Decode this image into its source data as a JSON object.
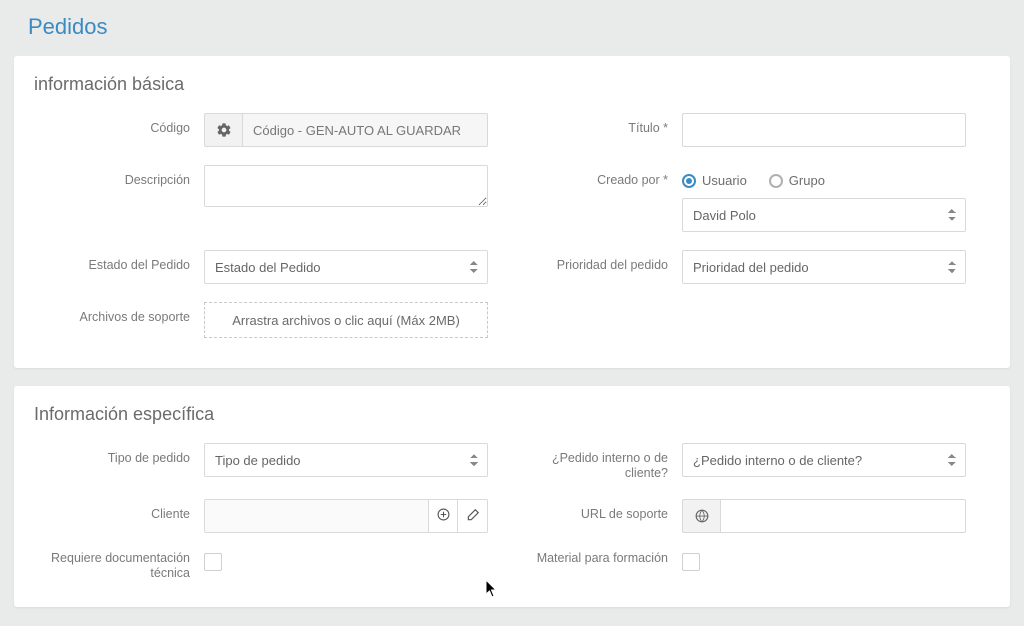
{
  "pageTitle": "Pedidos",
  "panels": {
    "basic": {
      "heading": "información básica",
      "codigoLabel": "Código",
      "codigoPlaceholder": "Código - GEN-AUTO AL GUARDAR",
      "tituloLabel": "Título *",
      "descripcionLabel": "Descripción",
      "creadoPorLabel": "Creado por *",
      "creadoPorOptions": {
        "usuario": "Usuario",
        "grupo": "Grupo"
      },
      "creadoPorSelected": "David Polo",
      "estadoLabel": "Estado del Pedido",
      "estadoPlaceholder": "Estado del Pedido",
      "prioridadLabel": "Prioridad del pedido",
      "prioridadPlaceholder": "Prioridad del pedido",
      "archivosLabel": "Archivos de soporte",
      "archivosHint": "Arrastra archivos o clic aquí (Máx 2MB)"
    },
    "specific": {
      "heading": "Información específica",
      "tipoLabel": "Tipo de pedido",
      "tipoPlaceholder": "Tipo de pedido",
      "internoLabel": "¿Pedido interno o de cliente?",
      "internoPlaceholder": "¿Pedido interno o de cliente?",
      "clienteLabel": "Cliente",
      "urlLabel": "URL de soporte",
      "reqDocLabel": "Requiere documentación técnica",
      "materialLabel": "Material para formación"
    }
  }
}
